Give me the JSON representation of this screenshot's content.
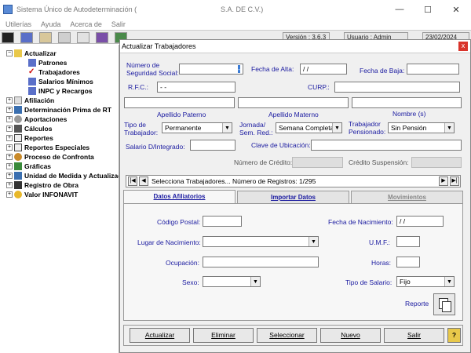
{
  "app": {
    "title": "Sistema Único de Autodeterminación (",
    "title_suffix": "S.A. DE C.V.)",
    "window_controls": {
      "minimize": "—",
      "maximize": "☐",
      "close": "✕"
    }
  },
  "menu": [
    "Utilerías",
    "Ayuda",
    "Acerca de",
    "Salir"
  ],
  "status": {
    "version": "Versión : 3.6.3",
    "user": "Usuario : Admin",
    "date": "23/02/2024"
  },
  "tree": {
    "items": [
      {
        "label": "Actualizar",
        "exp": "−",
        "icon": "folder"
      },
      {
        "label": "Patrones",
        "icon": "building"
      },
      {
        "label": "Trabajadores",
        "icon": "check"
      },
      {
        "label": "Salarios Mínimos",
        "icon": "building"
      },
      {
        "label": "INPC y Recargos",
        "icon": "building"
      },
      {
        "label": "Afiliación",
        "exp": "+",
        "icon": "doc"
      },
      {
        "label": "Determinación Prima de RT",
        "exp": "+",
        "icon": "grid"
      },
      {
        "label": "Aportaciones",
        "exp": "+",
        "icon": "coins"
      },
      {
        "label": "Cálculos",
        "exp": "+",
        "icon": "calc"
      },
      {
        "label": "Reportes",
        "exp": "+",
        "icon": "report"
      },
      {
        "label": "Reportes Especiales",
        "exp": "+",
        "icon": "report"
      },
      {
        "label": "Proceso de Confronta",
        "exp": "+",
        "icon": "process"
      },
      {
        "label": "Gráficas",
        "exp": "+",
        "icon": "chart"
      },
      {
        "label": "Unidad de Medida y Actualización",
        "exp": "+",
        "icon": "grid"
      },
      {
        "label": "Registro de Obra",
        "exp": "+",
        "icon": "tools"
      },
      {
        "label": "Valor INFONAVIT",
        "exp": "+",
        "icon": "coin"
      }
    ]
  },
  "dialog": {
    "title": "Actualizar Trabajadores",
    "close": "x",
    "nss_label_1": "Número de",
    "nss_label_2": "Seguridad Social:",
    "nss_value": "-",
    "fecha_alta_label": "Fecha de Alta:",
    "fecha_alta_value": "/ /",
    "fecha_baja_label": "Fecha de Baja:",
    "rfc_label": "R.F.C.:",
    "rfc_value": "-     -",
    "curp_label": "CURP.:",
    "ap_paterno": "Apellido Paterno",
    "ap_materno": "Apellido Materno",
    "nombres": "Nombre (s)",
    "tipo_trab_1": "Tipo de",
    "tipo_trab_2": "Trabajador:",
    "tipo_trab_value": "Permanente",
    "jornada_1": "Jornada/",
    "jornada_2": "Sem. Red.:",
    "jornada_value": "Semana Completa",
    "pensionado_1": "Trabajador",
    "pensionado_2": "Pensionado:",
    "pensionado_value": "Sin Pensión",
    "salario_label": "Salario D/Integrado:",
    "clave_ubic_label": "Clave de Ubicación:",
    "num_credito_label": "Número de Crédito:",
    "credito_susp_label": "Crédito Suspensión:"
  },
  "navbar": {
    "text": "Selecciona Trabajadores... Número de Registros: 1/295"
  },
  "tabs": [
    "Datos Afiliatorios",
    "Importar Datos",
    "Movimientos"
  ],
  "panel": {
    "cp_label": "Código Postal:",
    "fecha_nac_label": "Fecha de Nacimiento:",
    "fecha_nac_value": "/ /",
    "lugar_nac_label": "Lugar de Nacimiento:",
    "umf_label": "U.M.F.:",
    "ocupacion_label": "Ocupación:",
    "horas_label": "Horas:",
    "sexo_label": "Sexo:",
    "tipo_salario_label": "Tipo de Salario:",
    "tipo_salario_value": "Fijo",
    "reporte_label": "Reporte"
  },
  "buttons": [
    "Actualizar",
    "Eliminar",
    "Seleccionar",
    "Nuevo",
    "Salir"
  ],
  "help": "?"
}
